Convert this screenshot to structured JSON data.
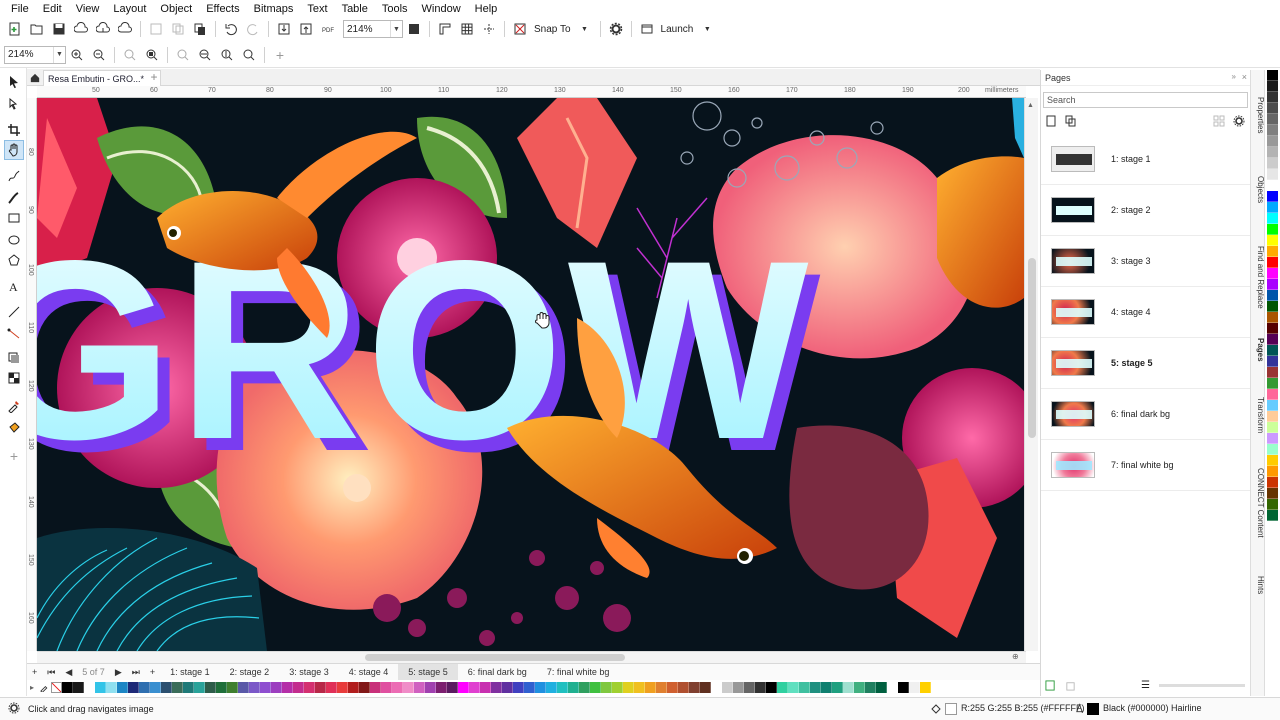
{
  "menu": [
    "File",
    "Edit",
    "View",
    "Layout",
    "Object",
    "Effects",
    "Bitmaps",
    "Text",
    "Table",
    "Tools",
    "Window",
    "Help"
  ],
  "toolbar": {
    "zoom_value": "214%",
    "snap_label": "Snap To",
    "launch_label": "Launch"
  },
  "toolbar2": {
    "zoom_value": "214%"
  },
  "document": {
    "tab_title": "Resa Embutin - GRO...*"
  },
  "rulers": {
    "unit": "millimeters",
    "h_ticks": [
      "50",
      "60",
      "70",
      "80",
      "90",
      "100",
      "110",
      "120",
      "130",
      "140",
      "150",
      "160",
      "170",
      "180",
      "190",
      "200"
    ],
    "v_ticks": [
      "80",
      "90",
      "100",
      "110",
      "120",
      "130",
      "140",
      "150",
      "160"
    ]
  },
  "canvas": {
    "headline": "GROW",
    "bg_color": "#07131c"
  },
  "pagenav": {
    "counter": "5 of 7",
    "tabs": [
      "1: stage 1",
      "2: stage 2",
      "3: stage 3",
      "4: stage 4",
      "5: stage 5",
      "6: final dark bg",
      "7: final white bg"
    ],
    "active_index": 4
  },
  "pages_panel": {
    "title": "Pages",
    "search_placeholder": "Search",
    "pages": [
      "1: stage 1",
      "2: stage 2",
      "3: stage 3",
      "4: stage 4",
      "5: stage 5",
      "6: final dark bg",
      "7: final white bg"
    ],
    "selected_index": 4
  },
  "side_tabs": [
    "Properties",
    "Objects",
    "Find and Replace",
    "Pages",
    "Transform",
    "CONNECT Content",
    "Hints"
  ],
  "statusbar": {
    "hint": "Click and drag navigates image",
    "fill_readout": "R:255 G:255 B:255 (#FFFFFF)",
    "outline_readout": "Black (#000000)  Hairline"
  },
  "palette_colors": [
    "#000000",
    "#1a1a1a",
    "#ffffff",
    "#33c4e8",
    "#8fe0f0",
    "#1d86c5",
    "#1e2a78",
    "#2f6fb0",
    "#3a8fd0",
    "#2c5070",
    "#3b6d5a",
    "#1f7a78",
    "#2aa39a",
    "#2e5d4a",
    "#1f6f3a",
    "#3f7f2f",
    "#5a59a8",
    "#7b58c8",
    "#8f4fd0",
    "#9d3fc0",
    "#b52fa8",
    "#c32d8e",
    "#d43070",
    "#b82848",
    "#e03058",
    "#e83c3c",
    "#b21e1e",
    "#821818",
    "#c8307a",
    "#e050a0",
    "#ec6cb4",
    "#f08cc8",
    "#d060c0",
    "#a040b0",
    "#7c1e70",
    "#5a1a60",
    "#ff00ff",
    "#e040d0",
    "#c830b0",
    "#8030a0",
    "#6030a0",
    "#4040c0",
    "#3060d0",
    "#2090e0",
    "#20b0e0",
    "#20c0c0",
    "#20b090",
    "#30a060",
    "#40c040",
    "#80c840",
    "#a0d030",
    "#e0d020",
    "#f0c020",
    "#f0a020",
    "#e08030",
    "#d06030",
    "#b05030",
    "#804030",
    "#603020",
    "#ffffff",
    "#cccccc",
    "#999999",
    "#666666",
    "#333333",
    "#000000",
    "#30d0a0",
    "#60e0c0",
    "#40c0a0",
    "#209080",
    "#108070",
    "#20a080",
    "#a0e0d0",
    "#40b080",
    "#208060",
    "#006040",
    "#ffffff",
    "#000000",
    "#f0f0f0",
    "#ffd000"
  ],
  "right_palette_colors": [
    "#000000",
    "#1a1a1a",
    "#333333",
    "#4d4d4d",
    "#666666",
    "#808080",
    "#999999",
    "#b3b3b3",
    "#cccccc",
    "#e6e6e6",
    "#ffffff",
    "#0000ff",
    "#00aaff",
    "#00ffff",
    "#00ff00",
    "#ffff00",
    "#ffaa00",
    "#ff0000",
    "#ff00ff",
    "#aa00ff",
    "#0055aa",
    "#005500",
    "#aa5500",
    "#550000",
    "#550055",
    "#005555",
    "#333399",
    "#993333",
    "#339933",
    "#ff6699",
    "#66ccff",
    "#ffcc99",
    "#ccff99",
    "#cc99ff",
    "#99ffcc",
    "#ffcc00",
    "#ff9900",
    "#cc3300",
    "#663300",
    "#336600",
    "#006633"
  ],
  "colors": {
    "accent": "#1c84c6",
    "grow_top": "#eafdff",
    "grow_bottom": "#9ef2ff",
    "grow_shadow": "#7a3cf0"
  }
}
